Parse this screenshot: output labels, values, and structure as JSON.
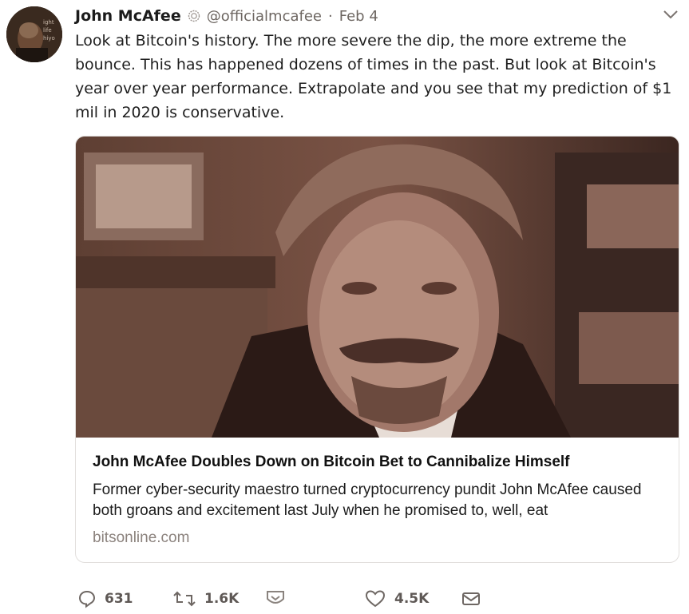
{
  "tweet": {
    "author_name": "John McAfee",
    "handle": "@officialmcafee",
    "separator": "·",
    "date": "Feb 4",
    "text": "Look at Bitcoin's history. The more severe the dip, the more extreme the bounce. This has happened dozens of times in the past. But look at Bitcoin's year over year performance. Extrapolate and you see that my prediction of $1 mil in 2020 is conservative.",
    "avatar_text": [
      "ight",
      "life",
      "hiyo"
    ]
  },
  "card": {
    "title": "John McAfee Doubles Down on Bitcoin Bet to Cannibalize Himself",
    "description": "Former cyber-security maestro turned cryptocurrency pundit John McAfee caused both groans and excitement last July when he promised to, well, eat",
    "domain": "bitsonline.com"
  },
  "actions": {
    "reply_count": "631",
    "retweet_count": "1.6K",
    "like_count": "4.5K"
  },
  "colors": {
    "background": "#ffffff",
    "secondary_text": "#6d6661",
    "card_border": "#e2dfdd",
    "sepia_image": "#8e6f62"
  }
}
